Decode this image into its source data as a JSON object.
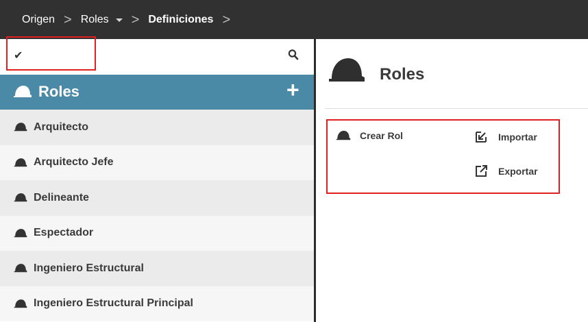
{
  "breadcrumb": {
    "items": [
      {
        "label": "Origen"
      },
      {
        "label": "Roles"
      },
      {
        "label": "Definiciones"
      }
    ],
    "separator": ">"
  },
  "left_panel": {
    "toolbar": {
      "check_icon": "check-icon",
      "search_icon": "search-icon"
    },
    "header": {
      "title": "Roles",
      "icon": "helmet-icon",
      "add_icon": "plus-icon",
      "add_symbol": "+",
      "background": "#4a8aa6"
    },
    "roles": [
      {
        "label": "Arquitecto"
      },
      {
        "label": "Arquitecto Jefe"
      },
      {
        "label": "Delineante"
      },
      {
        "label": "Espectador"
      },
      {
        "label": "Ingeniero Estructural"
      },
      {
        "label": "Ingeniero Estructural Principal"
      }
    ]
  },
  "right_panel": {
    "title": "Roles",
    "actions": {
      "create": {
        "label": "Crear Rol",
        "icon": "helmet-icon"
      },
      "import": {
        "label": "Importar",
        "icon": "import-icon"
      },
      "export": {
        "label": "Exportar",
        "icon": "export-icon"
      }
    }
  },
  "colors": {
    "topbar": "#313131",
    "accent": "#4a8aa6",
    "highlight_border": "#e02020"
  }
}
